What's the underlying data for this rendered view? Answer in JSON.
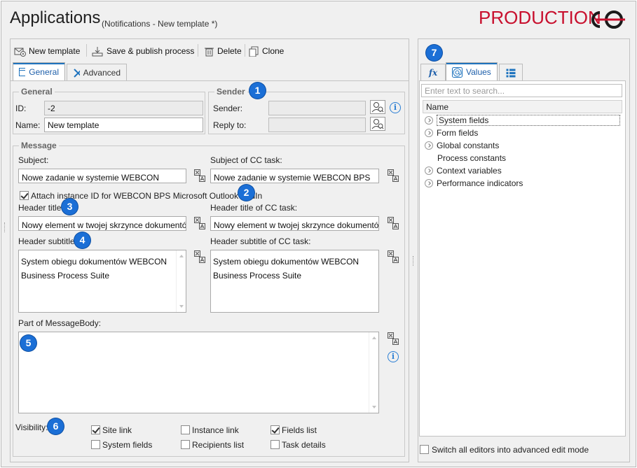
{
  "window": {
    "title": "Applications",
    "subtitle": "(Notifications - New template *)",
    "environment": "PRODUCTION"
  },
  "toolbar": {
    "new_template": "New template",
    "save_publish": "Save & publish process",
    "delete": "Delete",
    "clone": "Clone"
  },
  "tabs": {
    "general": "General",
    "advanced": "Advanced"
  },
  "general_group": {
    "legend": "General",
    "id_label": "ID:",
    "id_value": "-2",
    "name_label": "Name:",
    "name_value": "New template"
  },
  "sender_group": {
    "legend": "Sender",
    "sender_label": "Sender:",
    "reply_to_label": "Reply to:",
    "sender_value": "",
    "reply_to_value": ""
  },
  "message_group": {
    "legend": "Message",
    "subject_label": "Subject:",
    "subject_value": "Nowe zadanie w systemie WEBCON",
    "subject_cc_label": "Subject of CC task:",
    "subject_cc_value": "Nowe zadanie w systemie WEBCON BPS",
    "attach_label": "Attach instance ID for WEBCON BPS Microsoft Outlook AddIn",
    "attach_checked": true,
    "header_title_label": "Header title:",
    "header_title_value": "Nowy element w twojej skrzynce dokumentów",
    "header_title_cc_label": "Header title of CC task:",
    "header_title_cc_value": "Nowy element w twojej skrzynce dokumentów",
    "header_subtitle_label": "Header subtitle:",
    "header_subtitle_line1": "System obiegu dokumentów WEBCON",
    "header_subtitle_line2": "Business Process Suite",
    "header_subtitle_cc_label": "Header subtitle of CC task:",
    "header_subtitle_cc_line1": "System obiegu dokumentów WEBCON",
    "header_subtitle_cc_line2": "Business Process Suite",
    "body_label": "Part of MessageBody:",
    "body_value": ""
  },
  "visibility": {
    "label": "Visibility:",
    "site_link": "Site link",
    "site_link_checked": true,
    "instance_link": "Instance link",
    "instance_link_checked": false,
    "fields_list": "Fields list",
    "fields_list_checked": true,
    "system_fields": "System fields",
    "system_fields_checked": false,
    "recipients_list": "Recipients list",
    "recipients_list_checked": false,
    "task_details": "Task details",
    "task_details_checked": false
  },
  "badges": {
    "b1": "1",
    "b2": "2",
    "b3": "3",
    "b4": "4",
    "b5": "5",
    "b6": "6",
    "b7": "7"
  },
  "right_panel": {
    "tab_fx": "fx",
    "tab_values": "Values",
    "search_placeholder": "Enter text to search...",
    "tree_header": "Name",
    "items": [
      "System fields",
      "Form fields",
      "Global constants",
      "Process constants",
      "Context variables",
      "Performance indicators"
    ],
    "advanced_mode_label": "Switch all editors into advanced edit mode",
    "advanced_mode_checked": false
  },
  "colors": {
    "accent": "#1e73be",
    "badge": "#1b6fd6",
    "production": "#c8102e"
  }
}
